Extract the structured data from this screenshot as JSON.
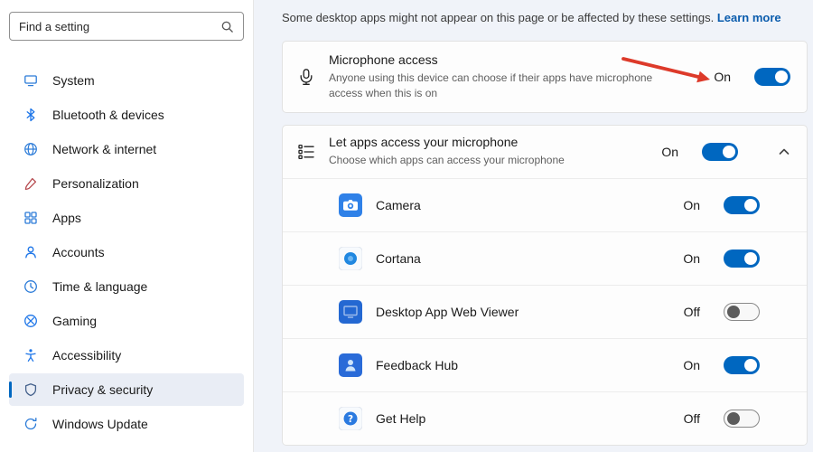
{
  "search": {
    "placeholder": "Find a setting"
  },
  "sidebar": {
    "items": [
      {
        "label": "System"
      },
      {
        "label": "Bluetooth & devices"
      },
      {
        "label": "Network & internet"
      },
      {
        "label": "Personalization"
      },
      {
        "label": "Apps"
      },
      {
        "label": "Accounts"
      },
      {
        "label": "Time & language"
      },
      {
        "label": "Gaming"
      },
      {
        "label": "Accessibility"
      },
      {
        "label": "Privacy & security",
        "selected": true
      },
      {
        "label": "Windows Update"
      }
    ]
  },
  "notice": {
    "text": "Some desktop apps might not appear on this page or be affected by these settings.",
    "link": "Learn more"
  },
  "mic_access": {
    "title": "Microphone access",
    "description": "Anyone using this device can choose if their apps have microphone access when this is on",
    "state": "On"
  },
  "let_apps": {
    "title": "Let apps access your microphone",
    "description": "Choose which apps can access your microphone",
    "state": "On"
  },
  "app_list": [
    {
      "name": "Camera",
      "state": "On"
    },
    {
      "name": "Cortana",
      "state": "On"
    },
    {
      "name": "Desktop App Web Viewer",
      "state": "Off"
    },
    {
      "name": "Feedback Hub",
      "state": "On"
    },
    {
      "name": "Get Help",
      "state": "Off"
    }
  ],
  "colors": {
    "accent": "#0067c0",
    "link": "#0b5cad",
    "arrow": "#dd3a2a",
    "toggle_off_knob": "#5c5c5c"
  }
}
